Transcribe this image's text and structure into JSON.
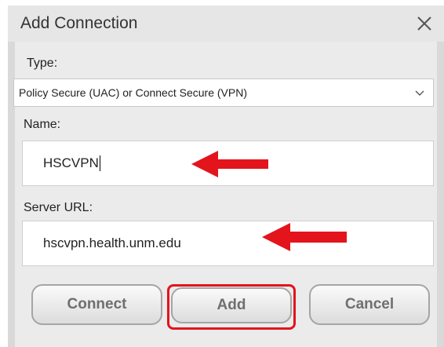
{
  "dialog": {
    "title": "Add Connection",
    "close_icon": "close-icon"
  },
  "type_field": {
    "label": "Type:",
    "selected_value": "Policy Secure (UAC) or Connect Secure (VPN)",
    "chevron_icon": "chevron-down-icon"
  },
  "name_field": {
    "label": "Name:",
    "value": "HSCVPN"
  },
  "server_field": {
    "label": "Server URL:",
    "value": "hscvpn.health.unm.edu"
  },
  "buttons": {
    "connect_label": "Connect",
    "add_label": "Add",
    "cancel_label": "Cancel"
  },
  "annotations": {
    "arrow_color": "#e3141b",
    "highlight_color": "#e3141b"
  }
}
